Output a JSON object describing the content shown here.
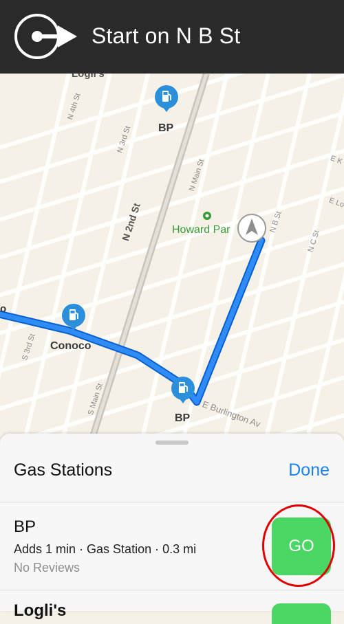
{
  "banner": {
    "instruction": "Start on N B St",
    "icon": "depart-arrow-icon",
    "bg_color": "#2a2a2a"
  },
  "map": {
    "top_label": "Logli's",
    "streets": [
      "N 4th St",
      "N 3rd St",
      "N 2nd St",
      "N Main St",
      "N B St",
      "N C St",
      "S 3rd St",
      "S Main St",
      "E Burlington Av",
      "E K",
      "E Lo"
    ],
    "pois": [
      {
        "name": "BP",
        "icon": "gas-station-icon"
      },
      {
        "name": "Conoco",
        "icon": "gas-station-icon"
      },
      {
        "name": "BP",
        "icon": "gas-station-icon"
      }
    ],
    "park": "Howard Par",
    "route_color": "#1a7df2",
    "left_edge_label": "o"
  },
  "sheet": {
    "title": "Gas Stations",
    "done_label": "Done",
    "results": [
      {
        "name": "BP",
        "detail": "Adds 1 min · Gas Station · 0.3 mi",
        "reviews": "No Reviews",
        "go_label": "GO"
      }
    ],
    "next_name_partial": "Logli's",
    "accent_color": "#1a82f0",
    "go_color": "#49d662"
  }
}
